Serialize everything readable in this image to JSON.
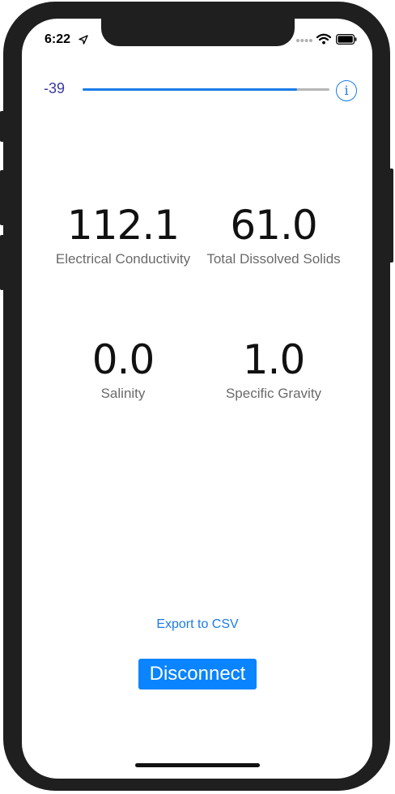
{
  "status_bar": {
    "time": "6:22",
    "icons": [
      "location-arrow-icon",
      "signal-dots-icon",
      "wifi-icon",
      "battery-icon"
    ]
  },
  "signal": {
    "rssi": "-39",
    "slider_fraction": 0.87,
    "info_label": "i"
  },
  "metrics": [
    {
      "value": "112.1",
      "label": "Electrical Conductivity"
    },
    {
      "value": "61.0",
      "label": "Total Dissolved Solids"
    },
    {
      "value": "0.0",
      "label": "Salinity"
    },
    {
      "value": "1.0",
      "label": "Specific Gravity"
    }
  ],
  "actions": {
    "export_label": "Export to CSV",
    "disconnect_label": "Disconnect"
  },
  "colors": {
    "accent": "#1a7ce8",
    "button": "#0a84ff",
    "rssi_text": "#3a3aa0"
  }
}
